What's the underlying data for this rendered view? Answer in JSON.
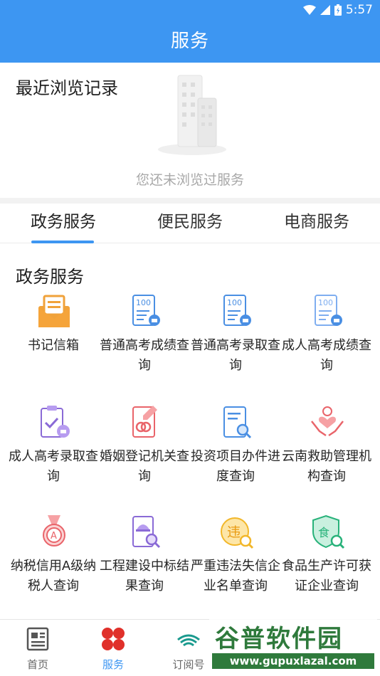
{
  "status_bar": {
    "time": "5:57"
  },
  "header": {
    "title": "服务"
  },
  "recent": {
    "title": "最近浏览记录",
    "empty_text": "您还未浏览过服务"
  },
  "tabs": [
    {
      "label": "政务服务",
      "active": true
    },
    {
      "label": "便民服务",
      "active": false
    },
    {
      "label": "电商服务",
      "active": false
    }
  ],
  "section": {
    "title": "政务服务",
    "items": [
      {
        "label": "书记信箱",
        "icon": "mailbox-icon"
      },
      {
        "label": "普通高考成绩查询",
        "icon": "score-report-icon"
      },
      {
        "label": "普通高考录取查询",
        "icon": "admission-report-icon"
      },
      {
        "label": "成人高考成绩查询",
        "icon": "adult-score-icon"
      },
      {
        "label": "成人高考录取查询",
        "icon": "clipboard-check-icon"
      },
      {
        "label": "婚姻登记机关查询",
        "icon": "marriage-icon"
      },
      {
        "label": "投资项目办件进度查询",
        "icon": "document-search-icon"
      },
      {
        "label": "云南救助管理机构查询",
        "icon": "helping-hands-icon"
      },
      {
        "label": "纳税信用A级纳税人查询",
        "icon": "medal-icon"
      },
      {
        "label": "工程建设中标结果查询",
        "icon": "construction-icon"
      },
      {
        "label": "严重违法失信企业名单查询",
        "icon": "violation-icon"
      },
      {
        "label": "食品生产许可获证企业查询",
        "icon": "food-license-icon"
      }
    ]
  },
  "bottom_nav": [
    {
      "label": "首页",
      "icon": "home-news-icon",
      "active": false
    },
    {
      "label": "服务",
      "icon": "services-grid-icon",
      "active": true
    },
    {
      "label": "订阅号",
      "icon": "subscription-icon",
      "active": false
    }
  ],
  "watermark": {
    "main": "谷普软件园",
    "url": "www.gupuxlazal.com"
  },
  "colors": {
    "primary": "#3d96f2",
    "watermark": "#2f7a3c"
  }
}
